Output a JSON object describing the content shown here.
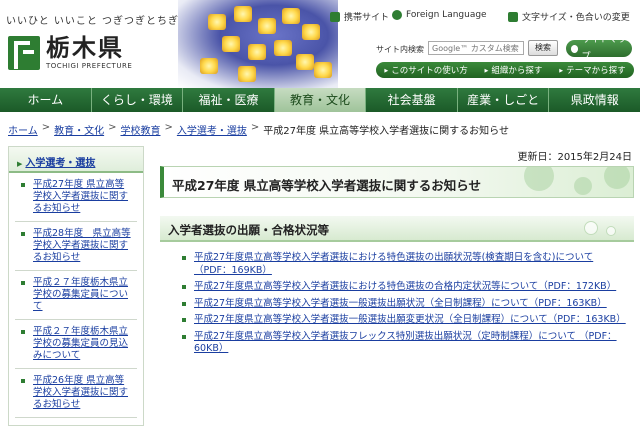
{
  "header": {
    "slogan": "いいひと いいこと つぎつぎとちぎ",
    "logo_jp": "栃木県",
    "logo_en": "TOCHIGI PREFECTURE",
    "util_links": [
      "携帯サイト",
      "Foreign Language",
      "文字サイズ・色合いの変更"
    ],
    "search_label": "サイト内検索",
    "search_placeholder": "Google™ カスタム検索",
    "search_button": "検索",
    "sitemap": "サイトマップ",
    "subnav": [
      "このサイトの使い方",
      "組織から探す",
      "テーマから探す"
    ]
  },
  "gnav": [
    "ホーム",
    "くらし・環境",
    "福祉・医療",
    "教育・文化",
    "社会基盤",
    "産業・しごと",
    "県政情報"
  ],
  "breadcrumb": [
    "ホーム",
    "教育・文化",
    "学校教育",
    "入学選考・選抜",
    "平成27年度 県立高等学校入学者選抜に関するお知らせ"
  ],
  "sidebar": {
    "heading": "入学選考・選抜",
    "items": [
      "平成27年度 県立高等学校入学者選抜に関するお知らせ",
      "平成28年度　県立高等学校入学者選抜に関するお知らせ",
      "平成２７年度栃木県立学校の募集定員について",
      "平成２７年度栃木県立学校の募集定員の見込みについて",
      "平成26年度 県立高等学校入学者選抜に関するお知らせ"
    ]
  },
  "main": {
    "updated": "更新日：2015年2月24日",
    "title": "平成27年度 県立高等学校入学者選抜に関するお知らせ",
    "section_title": "入学者選抜の出願・合格状況等",
    "links": [
      "平成27年度県立高等学校入学者選抜における特色選抜の出願状況等(検査期日を含む)について（PDF：169KB）",
      "平成27年度県立高等学校入学者選抜における特色選抜の合格内定状況等について（PDF：172KB）",
      "平成27年度県立高等学校入学者選抜一般選抜出願状況（全日制課程）について（PDF：163KB）",
      "平成27年度県立高等学校入学者選抜一般選抜出願変更状況（全日制課程）について（PDF：163KB）",
      "平成27年度県立高等学校入学者選抜フレックス特別選抜出願状況（定時制課程）について （PDF：60KB）"
    ]
  },
  "colors": {
    "brand_green": "#2e7d32",
    "link_blue": "#1a3ea0",
    "nav_active": "#b3d3ad"
  }
}
